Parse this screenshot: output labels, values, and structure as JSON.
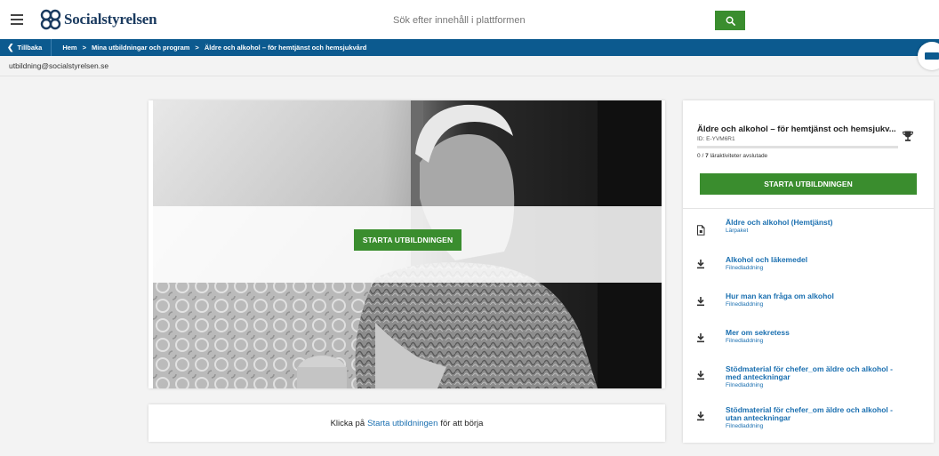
{
  "header": {
    "logo_text": "Socialstyrelsen",
    "search_placeholder": "Sök efter innehåll i plattformen",
    "menu_icon": "hamburger-icon",
    "search_icon": "search-icon"
  },
  "nav": {
    "back_label": "Tillbaka",
    "crumbs": [
      "Hem",
      "Mina utbildningar och program",
      "Äldre och alkohol – för hemtjänst och hemsjukvård"
    ]
  },
  "user": {
    "email": "utbildning@socialstyrelsen.se"
  },
  "hero": {
    "start_label": "STARTA UTBILDNINGEN"
  },
  "hint": {
    "prefix": "Klicka på",
    "link": "Starta utbildningen",
    "suffix": "för att börja"
  },
  "course": {
    "title": "Äldre och alkohol – för hemtjänst och hemsjukv...",
    "id": "ID: E-YVM6R1",
    "progress": {
      "done": 0,
      "total": 7,
      "done_label": "0",
      "total_label": "7",
      "suffix": "läraktiviteter avslutade",
      "separator": "/"
    },
    "start_label": "STARTA UTBILDNINGEN"
  },
  "activities": [
    {
      "title": "Äldre och alkohol (Hemtjänst)",
      "type": "Lärpaket",
      "icon": "document-icon"
    },
    {
      "title": "Alkohol och läkemedel",
      "type": "Filnedladdning",
      "icon": "download-icon"
    },
    {
      "title": "Hur man kan fråga om alkohol",
      "type": "Filnedladdning",
      "icon": "download-icon"
    },
    {
      "title": "Mer om sekretess",
      "type": "Filnedladdning",
      "icon": "download-icon"
    },
    {
      "title_lines": [
        "Stödmaterial för chefer_om äldre och alkohol -",
        "med anteckningar"
      ],
      "type": "Filnedladdning",
      "icon": "download-icon"
    },
    {
      "title_lines": [
        "Stödmaterial för chefer_om äldre och alkohol -",
        "utan anteckningar"
      ],
      "type": "Filnedladdning",
      "icon": "download-icon"
    }
  ],
  "colors": {
    "brand_blue": "#0c5a8f",
    "action_green": "#3a8d2e",
    "link_blue": "#1a6fb0"
  }
}
